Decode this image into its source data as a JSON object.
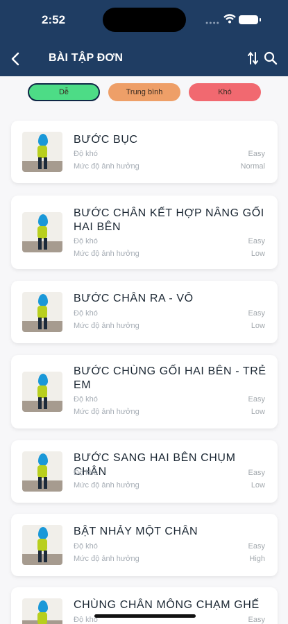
{
  "status": {
    "time": "2:52"
  },
  "header": {
    "title": "BÀI TẬP ĐƠN"
  },
  "filters": {
    "easy": "Dễ",
    "medium": "Trung bình",
    "hard": "Khó"
  },
  "row_labels": {
    "difficulty": "Độ khó",
    "impact": "Mức độ ảnh hưởng"
  },
  "exercises": [
    {
      "name": "BƯỚC BỤC",
      "difficulty": "Easy",
      "impact": "Normal"
    },
    {
      "name": "BƯỚC CHÂN KẾT HỢP NÂNG GỐI HAI BÊN",
      "difficulty": "Easy",
      "impact": "Low"
    },
    {
      "name": "BƯỚC CHÂN RA - VÔ",
      "difficulty": "Easy",
      "impact": "Low"
    },
    {
      "name": "BƯỚC CHÙNG GỐI HAI BÊN - TRẺ EM",
      "difficulty": "Easy",
      "impact": "Low"
    },
    {
      "name": "BƯỚC SANG HAI BÊN CHỤM CHÂN",
      "difficulty": "Easy",
      "impact": "Low"
    },
    {
      "name": "BẬT NHẢY MỘT CHÂN",
      "difficulty": "Easy",
      "impact": "High"
    },
    {
      "name": "CHÙNG CHÂN MÔNG CHẠM GHẾ",
      "difficulty": "Easy",
      "impact": ""
    }
  ],
  "colors": {
    "header": "#1f3d63",
    "easy": "#4ddc86",
    "medium": "#ee9f68",
    "hard": "#f16970"
  }
}
